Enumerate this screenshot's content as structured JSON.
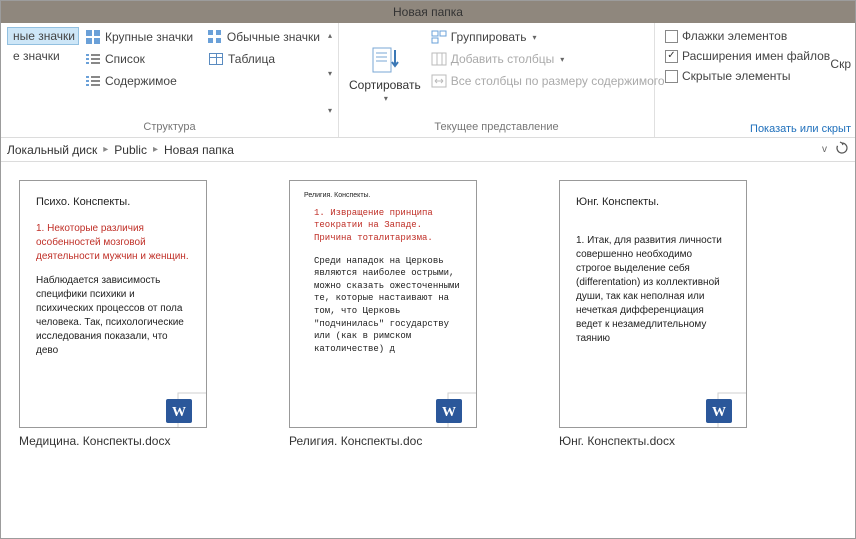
{
  "window": {
    "title": "Новая папка"
  },
  "ribbon": {
    "layout": {
      "label": "Структура",
      "items": {
        "huge_icons": "ные значки",
        "medium_icons": "е значки",
        "large_icons": "Крупные значки",
        "list": "Список",
        "content": "Содержимое",
        "normal_icons": "Обычные значки",
        "table": "Таблица"
      }
    },
    "view": {
      "label": "Текущее представление",
      "sort": "Сортировать",
      "group": "Группировать",
      "add_columns": "Добавить столбцы",
      "fit_columns": "Все столбцы по размеру содержимого"
    },
    "show": {
      "item_checkboxes": "Флажки элементов",
      "file_extensions": "Расширения имен файлов",
      "hidden_items": "Скрытые элементы",
      "right_cut": "Показать или скрыт",
      "top_cut": "Скр"
    }
  },
  "breadcrumb": {
    "parts": [
      "Локальный диск",
      "Public",
      "Новая папка"
    ]
  },
  "files": [
    {
      "name": "Медицина. Конспекты.docx",
      "preview": {
        "title": "Психо. Конспекты.",
        "heading": "1. Некоторые различия особенностей мозговой деятельности мужчин и женщин.",
        "body": "Наблюдается зависимость специфики психики и психических процессов от пола человека. Так, психологические исследования показали, что дево"
      }
    },
    {
      "name": "Религия. Конспекты.doc",
      "preview": {
        "title": "Религия. Конспекты.",
        "heading": "1. Извращение принципа теократии на Западе. Причина тоталитаризма.",
        "body": "Среди нападок на Церковь являются наиболее острыми, можно сказать ожесточенными те, которые настаивают на том, что Церковь \"подчинилась\" государству или (как в римском католичестве) д"
      }
    },
    {
      "name": "Юнг. Конспекты.docx",
      "preview": {
        "title": "Юнг. Конспекты.",
        "heading": "",
        "body": "1. Итак, для развития личности совершенно необходимо строгое выделение себя (differentation) из коллективной души, так как неполная или нечеткая дифференциация ведет к незамедлительному таянию"
      }
    }
  ]
}
